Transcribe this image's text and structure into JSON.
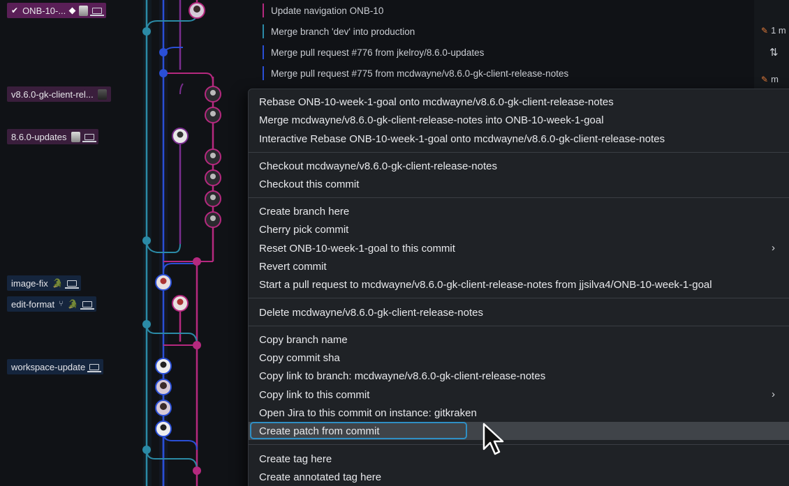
{
  "branches": [
    {
      "label": "ONB-10-...",
      "style": "purple-strong"
    },
    {
      "label": "v8.6.0-gk-client-rel...",
      "style": "purple"
    },
    {
      "label": "8.6.0-updates",
      "style": "purple"
    },
    {
      "label": "image-fix",
      "style": "blue"
    },
    {
      "label": "edit-format",
      "style": "blue"
    },
    {
      "label": "workspace-update",
      "style": "blue"
    }
  ],
  "commit_messages": [
    "Update navigation ONB-10",
    "Merge branch 'dev' into production",
    "Merge pull request #776 from jkelroy/8.6.0-updates",
    "Merge pull request #775 from mcdwayne/v8.6.0-gk-client-release-notes"
  ],
  "right_panel": {
    "item1": "1 m",
    "item2": "m"
  },
  "context_menu": {
    "items": [
      "Rebase ONB-10-week-1-goal onto mcdwayne/v8.6.0-gk-client-release-notes",
      "Merge mcdwayne/v8.6.0-gk-client-release-notes into ONB-10-week-1-goal",
      "Interactive Rebase ONB-10-week-1-goal onto mcdwayne/v8.6.0-gk-client-release-notes",
      "Checkout mcdwayne/v8.6.0-gk-client-release-notes",
      "Checkout this commit",
      "Create branch here",
      "Cherry pick commit",
      "Reset ONB-10-week-1-goal to this commit",
      "Revert commit",
      "Start a pull request to mcdwayne/v8.6.0-gk-client-release-notes from jjsilva4/ONB-10-week-1-goal",
      "Delete mcdwayne/v8.6.0-gk-client-release-notes",
      "Copy branch name",
      "Copy commit sha",
      "Copy link to branch: mcdwayne/v8.6.0-gk-client-release-notes",
      "Copy link to this commit",
      "Open Jira to this commit on instance: gitkraken",
      "Create patch from commit",
      "Create tag here",
      "Create annotated tag here"
    ],
    "highlighted": "Create patch from commit"
  },
  "colors": {
    "lane_teal": "#2b8aa6",
    "lane_blue": "#2a4fd6",
    "lane_magenta": "#b5297f",
    "lane_purple": "#7a2e8e",
    "focus": "#2f8fc4"
  }
}
